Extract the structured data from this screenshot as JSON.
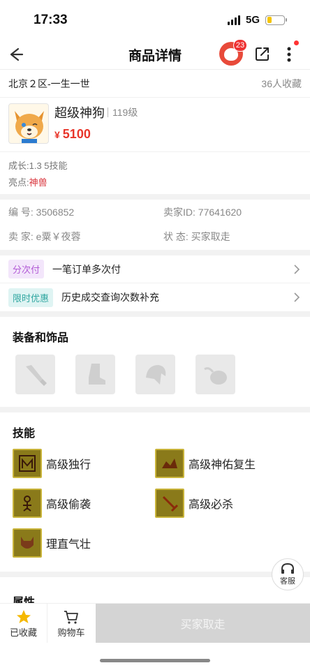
{
  "status": {
    "time": "17:33",
    "network": "5G"
  },
  "nav": {
    "title": "商品详情",
    "badge_count": "23"
  },
  "listing": {
    "server": "北京２区-一生一世",
    "favorites": "36人收藏",
    "pet_name": "超级神狗",
    "pet_level": "119级",
    "price_symbol": "¥",
    "price": "5100",
    "growth": "成长:1.3 5技能",
    "highlight_label": "亮点:",
    "highlight_value": "神兽"
  },
  "details": {
    "id_label": "编 号:",
    "id_value": "3506852",
    "seller_id_label": "卖家ID:",
    "seller_id_value": "77641620",
    "seller_label": "卖 家:",
    "seller_value": "e粟￥夜蓉",
    "state_label": "状 态:",
    "state_value": "买家取走"
  },
  "promos": [
    {
      "tag": "分次付",
      "text": "一笔订单多次付"
    },
    {
      "tag": "限时优惠",
      "text": "历史成交查询次数补充"
    }
  ],
  "equipment": {
    "title": "装备和饰品"
  },
  "skills": {
    "title": "技能",
    "items": [
      "高级独行",
      "高级神佑复生",
      "高级偷袭",
      "高级必杀",
      "理直气壮"
    ]
  },
  "attributes": {
    "title": "属性"
  },
  "service": {
    "label": "客服"
  },
  "bottom": {
    "fav_label": "已收藏",
    "cart_label": "购物车",
    "buy_label": "买家取走"
  },
  "colors": {
    "price": "#e8352a",
    "accent_red": "#d9363e",
    "buy_disabled": "#d4d4d4"
  }
}
